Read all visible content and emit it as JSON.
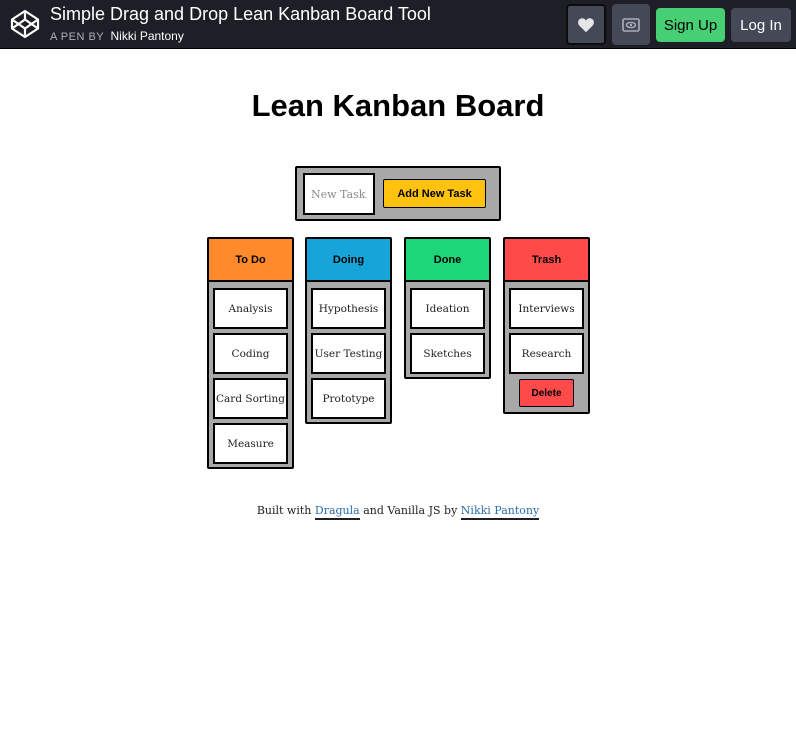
{
  "header": {
    "pen_title": "Simple Drag and Drop Lean Kanban Board Tool",
    "by_label": "A PEN BY",
    "author": "Nikki Pantony",
    "signup_label": "Sign Up",
    "login_label": "Log In",
    "accent_color": "#47cf73",
    "icons": [
      "codepen-logo-icon",
      "heart-icon",
      "eye-icon"
    ]
  },
  "page": {
    "title": "Lean Kanban Board"
  },
  "add_task": {
    "placeholder": "New Task...",
    "button_label": "Add New Task"
  },
  "columns": [
    {
      "title": "To Do",
      "color": "#ff8a2b",
      "cards": [
        "Analysis",
        "Coding",
        "Card Sorting",
        "Measure"
      ]
    },
    {
      "title": "Doing",
      "color": "#17a5d9",
      "cards": [
        "Hypothesis",
        "User Testing",
        "Prototype"
      ]
    },
    {
      "title": "Done",
      "color": "#1dd67a",
      "cards": [
        "Ideation",
        "Sketches"
      ]
    },
    {
      "title": "Trash",
      "color": "#ff4a4a",
      "cards": [
        "Interviews",
        "Research"
      ],
      "delete_label": "Delete"
    }
  ],
  "footer": {
    "text_before": "Built with",
    "link1": "Dragula",
    "text_middle": "and Vanilla JS by",
    "link2": "Nikki Pantony"
  }
}
